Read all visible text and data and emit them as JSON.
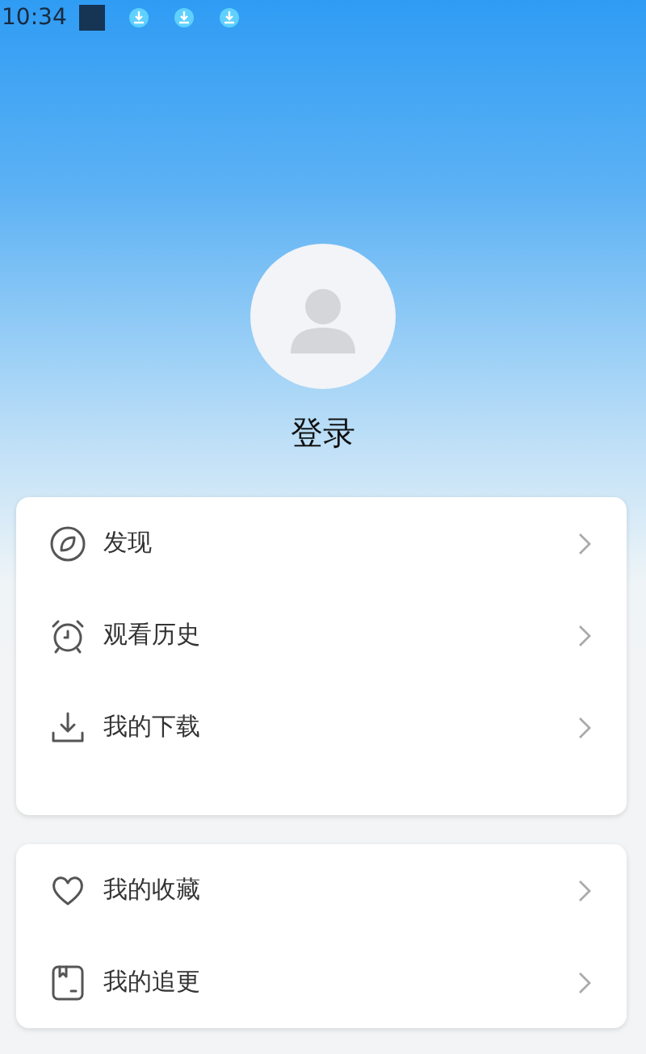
{
  "status_bar": {
    "time": "10:34"
  },
  "profile": {
    "login_label": "登录"
  },
  "menu_groups": [
    {
      "items": [
        {
          "kind": "compass",
          "label": "发现"
        },
        {
          "kind": "alarm",
          "label": "观看历史"
        },
        {
          "kind": "download",
          "label": "我的下载"
        }
      ]
    },
    {
      "items": [
        {
          "kind": "heart",
          "label": "我的收藏"
        },
        {
          "kind": "bookmark",
          "label": "我的追更"
        }
      ]
    }
  ]
}
